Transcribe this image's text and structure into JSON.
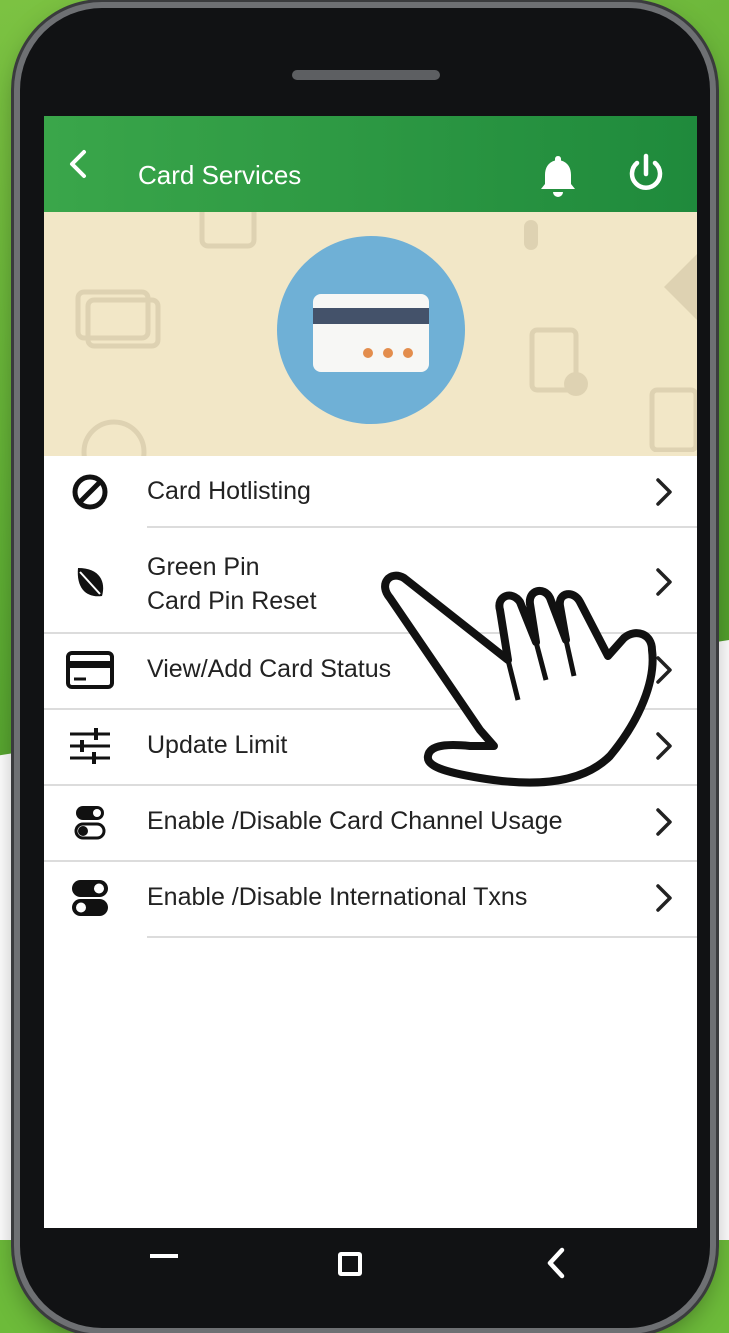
{
  "header": {
    "title": "Card Services",
    "back_icon": "chevron-left-icon",
    "notification_icon": "bell-icon",
    "logout_icon": "power-icon"
  },
  "hero": {
    "icon": "credit-card-icon"
  },
  "menu": [
    {
      "icon": "block-icon",
      "lines": [
        "Card Hotlisting"
      ]
    },
    {
      "icon": "leaf-icon",
      "lines": [
        "Green Pin",
        "Card Pin Reset"
      ]
    },
    {
      "icon": "card-icon",
      "lines": [
        "View/Add Card Status"
      ]
    },
    {
      "icon": "sliders-icon",
      "lines": [
        "Update Limit"
      ]
    },
    {
      "icon": "toggle-icon",
      "lines": [
        "Enable /Disable Card Channel Usage"
      ]
    },
    {
      "icon": "toggles-icon",
      "lines": [
        "Enable /Disable International Txns"
      ]
    }
  ],
  "navigation": {
    "recent": "recent-apps-icon",
    "home": "home-icon",
    "back": "back-icon"
  },
  "colors": {
    "app_bar": "#1f8a3c",
    "hero_bg": "#f2e7c7",
    "accent_green": "#6dbb3a"
  }
}
